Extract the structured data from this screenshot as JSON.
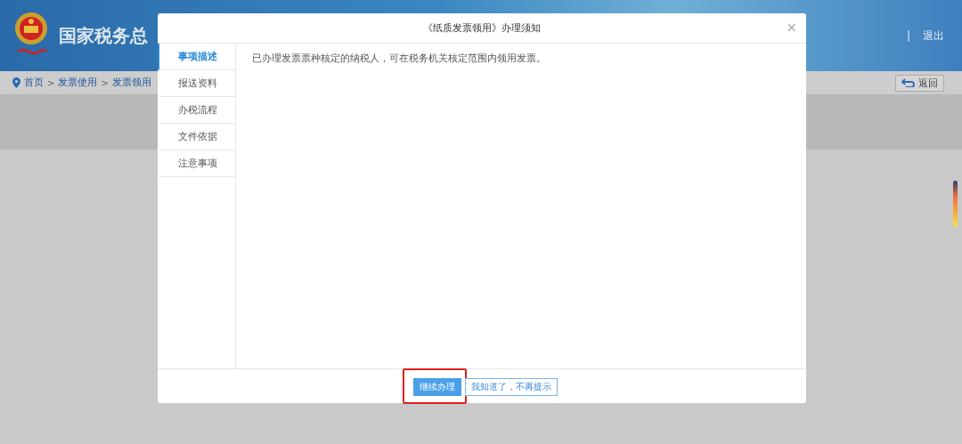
{
  "header": {
    "title": "国家税务总",
    "separator": "|",
    "logout": "退出"
  },
  "breadcrumb": {
    "items": [
      "首页",
      "发票使用",
      "发票领用"
    ],
    "separator": ">",
    "back": "返回"
  },
  "dialog": {
    "title": "《纸质发票领用》办理须知",
    "close": "×",
    "tabs": [
      {
        "label": "事项描述",
        "selected": true
      },
      {
        "label": "报送资料",
        "selected": false
      },
      {
        "label": "办税流程",
        "selected": false
      },
      {
        "label": "文件依据",
        "selected": false
      },
      {
        "label": "注意事项",
        "selected": false
      }
    ],
    "content": "已办理发票票种核定的纳税人，可在税务机关核定范围内领用发票。",
    "buttons": [
      {
        "label": "继续办理",
        "kind": "primary",
        "highlighted": true
      },
      {
        "label": "我知道了，不再提示",
        "kind": "secondary",
        "highlighted": false
      }
    ]
  }
}
